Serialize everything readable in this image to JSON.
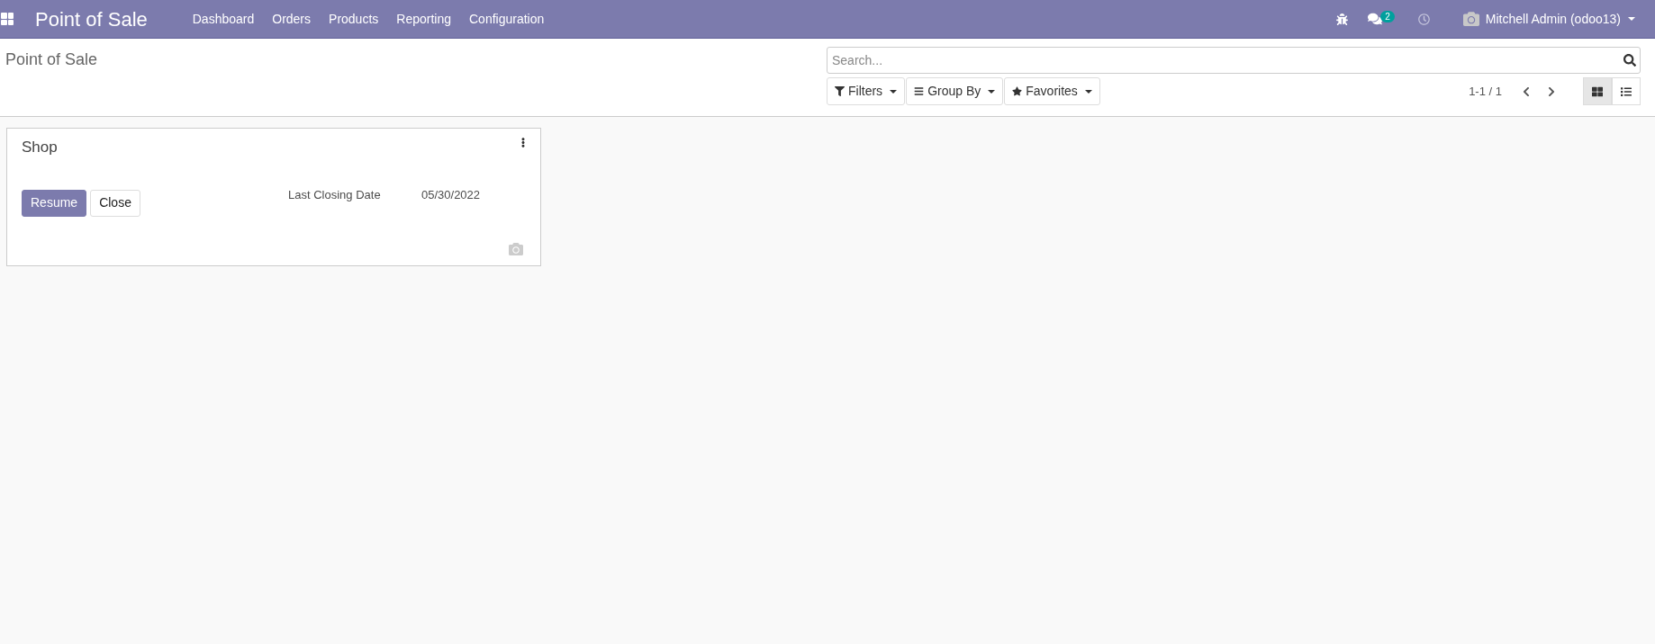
{
  "navbar": {
    "app_title": "Point of Sale",
    "menu": [
      "Dashboard",
      "Orders",
      "Products",
      "Reporting",
      "Configuration"
    ],
    "messages_count": "2",
    "user": "Mitchell Admin (odoo13)"
  },
  "control_panel": {
    "breadcrumb": "Point of Sale",
    "search": {
      "placeholder": "Search..."
    },
    "filters": [
      {
        "label": "Filters",
        "kind": "filter"
      },
      {
        "label": "Group By",
        "kind": "group"
      },
      {
        "label": "Favorites",
        "kind": "star"
      }
    ],
    "pager": "1-1 / 1",
    "views": [
      {
        "kind": "kanban",
        "selected": true
      },
      {
        "kind": "list",
        "selected": false
      }
    ]
  },
  "cards": [
    {
      "title": "Shop",
      "buttons": [
        {
          "label": "Resume",
          "kind": "primary"
        },
        {
          "label": "Close",
          "kind": "secondary"
        }
      ],
      "field_label": "Last Closing Date",
      "field_value": "05/30/2022"
    }
  ]
}
